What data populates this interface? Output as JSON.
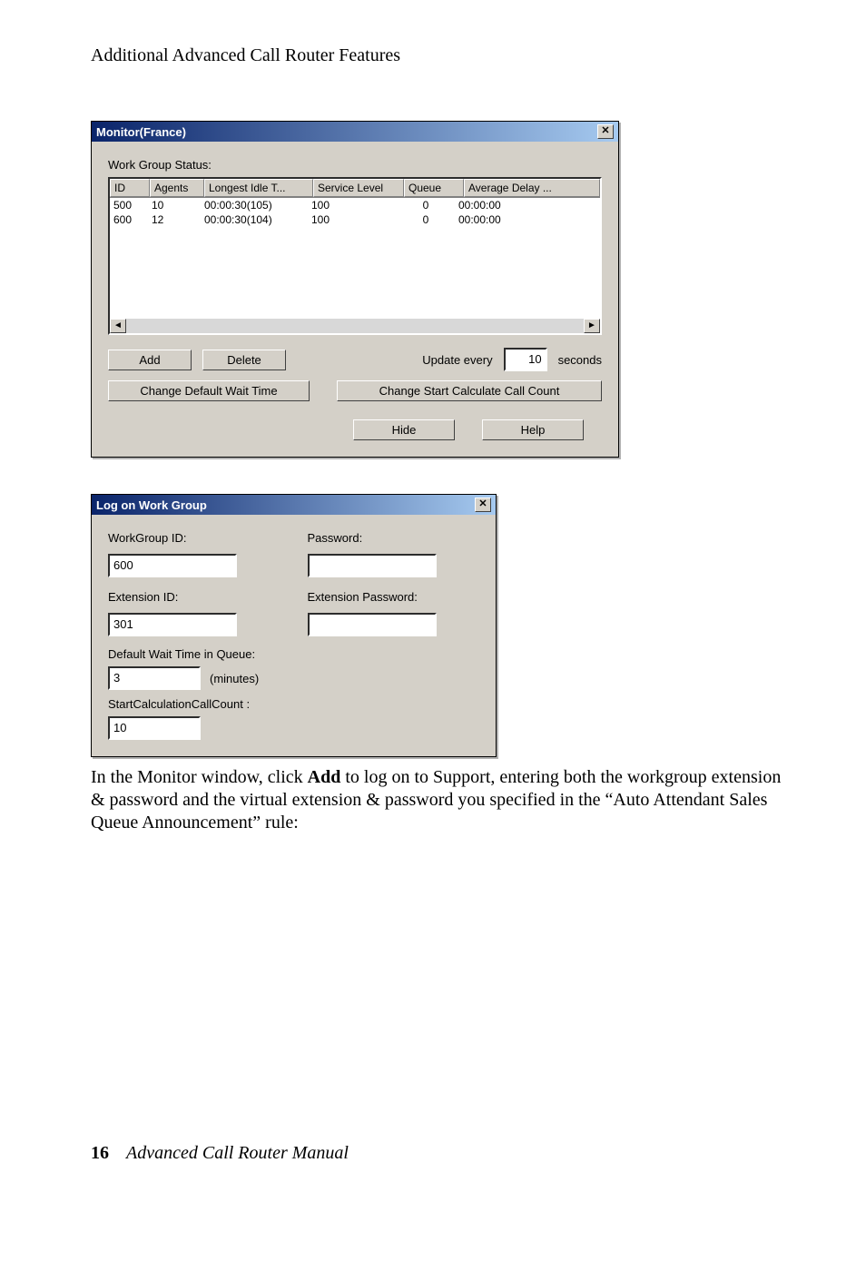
{
  "header": "Additional Advanced Call Router Features",
  "monitor": {
    "title": "Monitor(France)",
    "status_label": "Work Group Status:",
    "columns": {
      "id": "ID",
      "agents": "Agents",
      "longest": "Longest Idle T...",
      "service": "Service Level",
      "queue": "Queue",
      "avg": "Average Delay ..."
    },
    "rows": [
      {
        "id": "500",
        "agents": "10",
        "longest": "00:00:30(105)",
        "service": "100",
        "queue": "0",
        "avg": "00:00:00"
      },
      {
        "id": "600",
        "agents": "12",
        "longest": "00:00:30(104)",
        "service": "100",
        "queue": "0",
        "avg": "00:00:00"
      }
    ],
    "add": "Add",
    "delete": "Delete",
    "update_prefix": "Update every",
    "update_value": "10",
    "update_suffix": "seconds",
    "cdwt": "Change Default Wait Time",
    "csccc": "Change Start Calculate Call Count",
    "hide": "Hide",
    "help": "Help"
  },
  "logon": {
    "title": "Log on Work Group",
    "wg_label": "WorkGroup ID:",
    "wg_value": "600",
    "pw_label": "Password:",
    "ext_label": "Extension ID:",
    "ext_value": "301",
    "extpw_label": "Extension Password:",
    "dwt_label": "Default Wait Time in Queue:",
    "dwt_value": "3",
    "dwt_units": "(minutes)",
    "scc_label": "StartCalculationCallCount :",
    "scc_value": "10"
  },
  "body_text_1": "In the Monitor window, click ",
  "body_text_bold": "Add",
  "body_text_2": " to log on to Support, entering both the workgroup extension & password and the virtual extension & password you specified in the “Auto Attendant Sales Queue Announcement” rule:",
  "footer": {
    "page": "16",
    "title": "Advanced Call Router Manual"
  }
}
